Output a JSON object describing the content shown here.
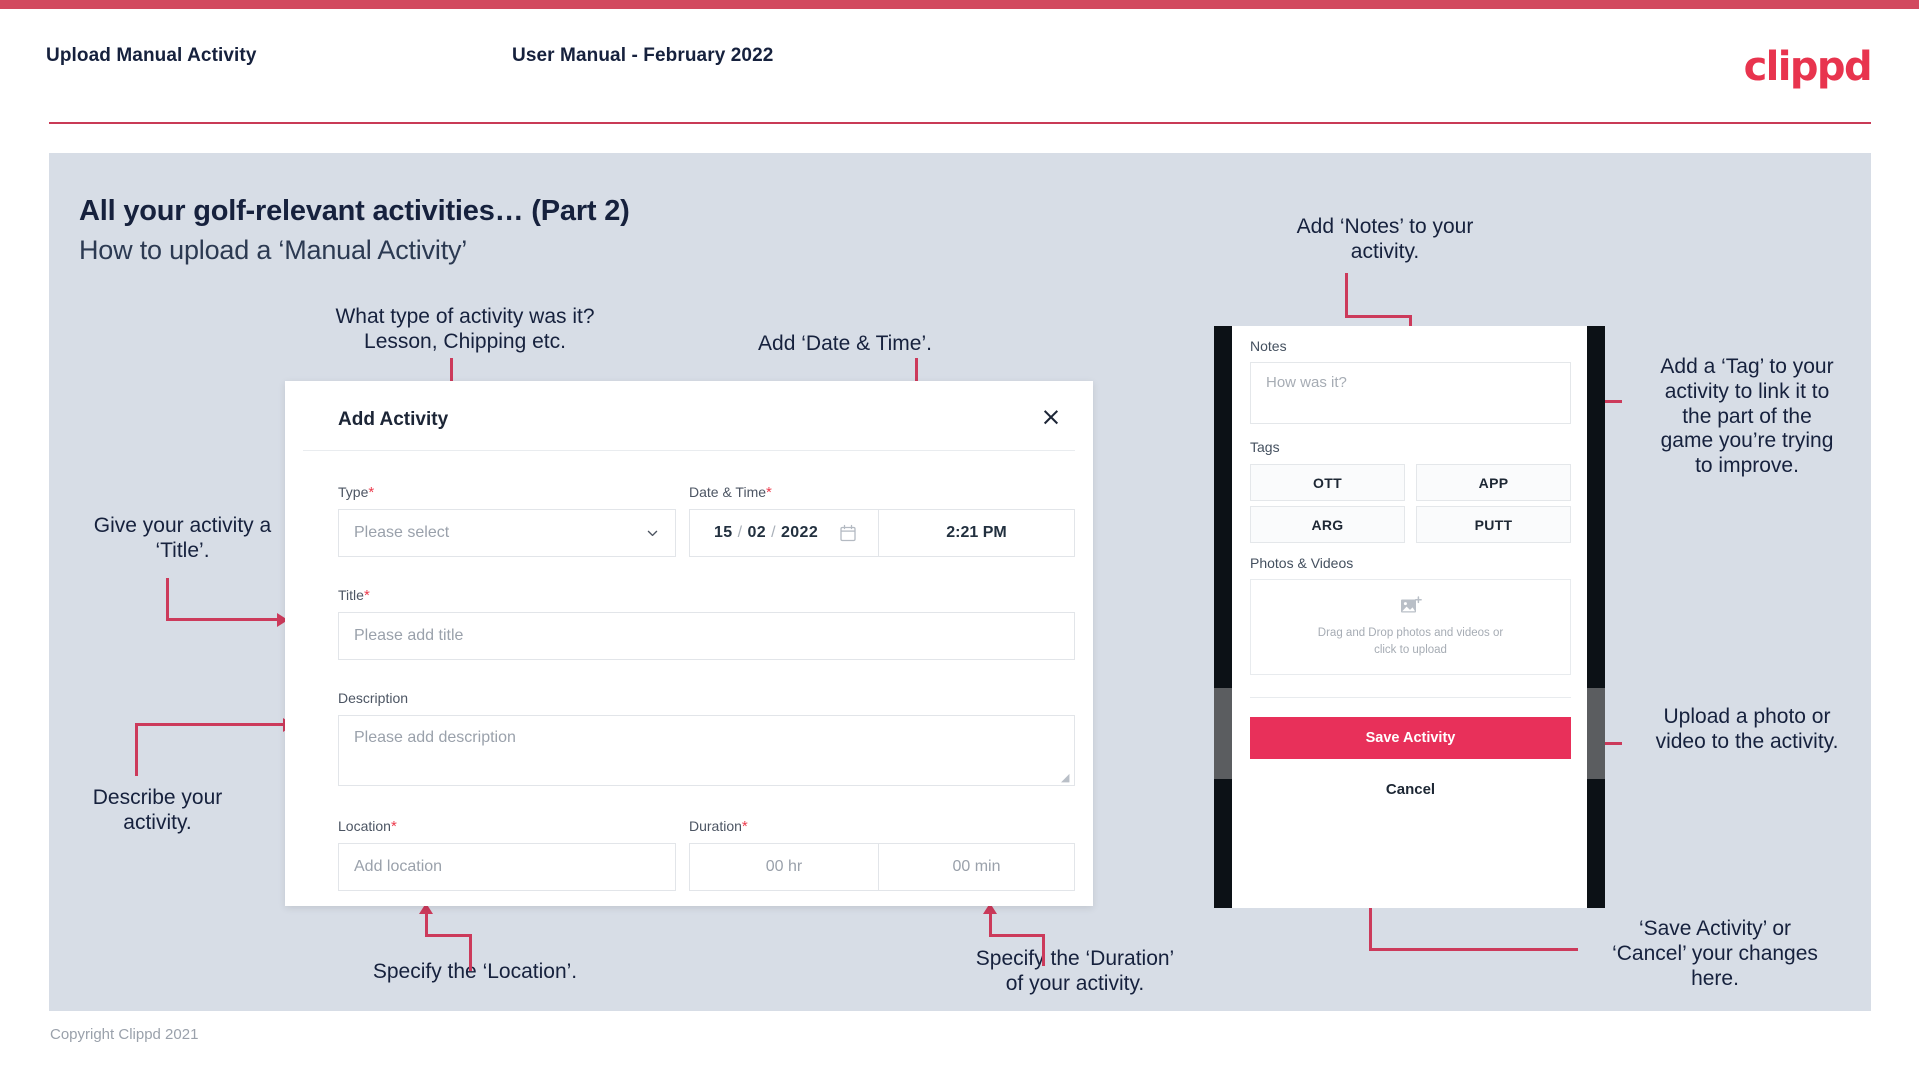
{
  "header": {
    "title": "Upload Manual Activity",
    "subtitle": "User Manual - February 2022",
    "logo": "clippd"
  },
  "slide": {
    "title": "All your golf-relevant activities… (Part 2)",
    "subtitle": "How to upload a ‘Manual Activity’"
  },
  "annotations": {
    "type": "What type of activity was it?\nLesson, Chipping etc.",
    "date_time": "Add ‘Date & Time’.",
    "title": "Give your activity a\n‘Title’.",
    "description": "Describe your\nactivity.",
    "location": "Specify the ‘Location’.",
    "duration": "Specify the ‘Duration’\nof your activity.",
    "notes": "Add ‘Notes’ to your\nactivity.",
    "tag": "Add a ‘Tag’ to your\nactivity to link it to\nthe part of the\ngame you’re trying\nto improve.",
    "upload": "Upload a photo or\nvideo to the activity.",
    "save_cancel": "‘Save Activity’ or\n‘Cancel’ your changes\nhere."
  },
  "dialog": {
    "title": "Add Activity",
    "close_icon": "×",
    "fields": {
      "type": {
        "label": "Type",
        "required": "*",
        "placeholder": "Please select"
      },
      "date_time": {
        "label": "Date & Time",
        "required": "*",
        "day": "15",
        "month": "02",
        "year": "2022",
        "sep": "/",
        "time": "2:21 PM"
      },
      "title": {
        "label": "Title",
        "required": "*",
        "placeholder": "Please add title"
      },
      "description": {
        "label": "Description",
        "required": "",
        "placeholder": "Please add description"
      },
      "location": {
        "label": "Location",
        "required": "*",
        "placeholder": "Add location"
      },
      "duration": {
        "label": "Duration",
        "required": "*",
        "hours_placeholder": "00 hr",
        "minutes_placeholder": "00 min"
      }
    }
  },
  "phone": {
    "notes": {
      "label": "Notes",
      "placeholder": "How was it?"
    },
    "tags": {
      "label": "Tags",
      "items": [
        "OTT",
        "APP",
        "ARG",
        "PUTT"
      ]
    },
    "photos": {
      "label": "Photos & Videos",
      "drop_line1": "Drag and Drop photos and videos or",
      "drop_line2": "click to upload"
    },
    "save_label": "Save Activity",
    "cancel_label": "Cancel"
  },
  "footer": {
    "copyright": "Copyright Clippd 2021"
  },
  "colors": {
    "accent": "#e8305a",
    "bar": "#d24a5f",
    "line": "#cc3a5b",
    "slide_bg": "#d7dde6",
    "text_dark": "#16213d"
  }
}
